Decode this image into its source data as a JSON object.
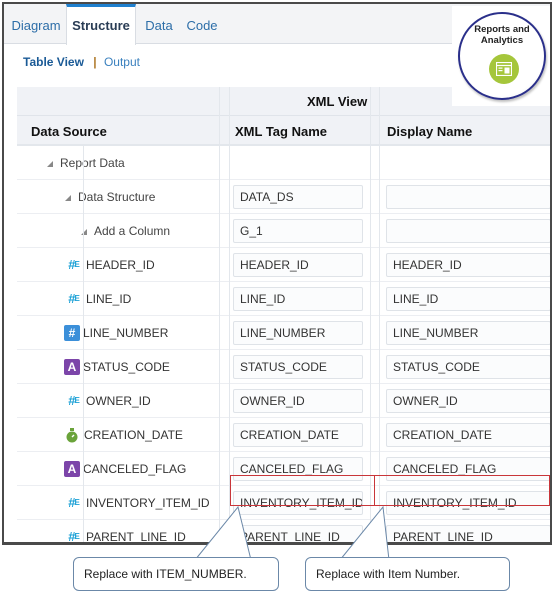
{
  "tabs": [
    {
      "label": "Diagram",
      "active": false
    },
    {
      "label": "Structure",
      "active": true
    },
    {
      "label": "Data",
      "active": false
    },
    {
      "label": "Code",
      "active": false
    }
  ],
  "subnav": {
    "selected": "Table View",
    "separator": "|",
    "link": "Output"
  },
  "badge": {
    "title_line1": "Reports and",
    "title_line2": "Analytics",
    "icon": "reports-analytics-icon",
    "accent": "#a5c63b"
  },
  "table": {
    "group_header": "XML View",
    "columns": [
      "Data Source",
      "XML Tag Name",
      "Display Name"
    ],
    "rows": [
      {
        "name": "Report Data",
        "icon": "collapse-triangle-icon",
        "xml_tag": null,
        "display": null
      },
      {
        "name": "Data Structure",
        "icon": "collapse-triangle-icon",
        "xml_tag": "DATA_DS",
        "display": ""
      },
      {
        "name": "Add a Column",
        "icon": "collapse-triangle-icon",
        "xml_tag": "G_1",
        "display": ""
      },
      {
        "name": "HEADER_ID",
        "icon": "number-type-icon",
        "xml_tag": "HEADER_ID",
        "display": "HEADER_ID"
      },
      {
        "name": "LINE_ID",
        "icon": "number-type-icon",
        "xml_tag": "LINE_ID",
        "display": "LINE_ID"
      },
      {
        "name": "LINE_NUMBER",
        "icon": "integer-type-icon",
        "xml_tag": "LINE_NUMBER",
        "display": "LINE_NUMBER"
      },
      {
        "name": "STATUS_CODE",
        "icon": "string-type-icon",
        "xml_tag": "STATUS_CODE",
        "display": "STATUS_CODE"
      },
      {
        "name": "OWNER_ID",
        "icon": "number-type-icon",
        "xml_tag": "OWNER_ID",
        "display": "OWNER_ID"
      },
      {
        "name": "CREATION_DATE",
        "icon": "date-type-icon",
        "xml_tag": "CREATION_DATE",
        "display": "CREATION_DATE"
      },
      {
        "name": "CANCELED_FLAG",
        "icon": "string-type-icon",
        "xml_tag": "CANCELED_FLAG",
        "display": "CANCELED_FLAG"
      },
      {
        "name": "INVENTORY_ITEM_ID",
        "icon": "number-type-icon",
        "xml_tag": "INVENTORY_ITEM_ID",
        "display": "INVENTORY_ITEM_ID",
        "highlighted": true
      },
      {
        "name": "PARENT_LINE_ID",
        "icon": "number-type-icon",
        "xml_tag": "PARENT_LINE_ID",
        "display": "PARENT_LINE_ID"
      }
    ]
  },
  "callouts": [
    {
      "text": "Replace with ITEM_NUMBER."
    },
    {
      "text": "Replace with Item Number."
    }
  ],
  "colors": {
    "tab_accent": "#1f80cf",
    "highlight": "#c9363a",
    "number_icon": "#1da1d6",
    "integer_icon": "#3b8fd9",
    "string_icon": "#7c45a9",
    "date_icon": "#6aa33a"
  }
}
